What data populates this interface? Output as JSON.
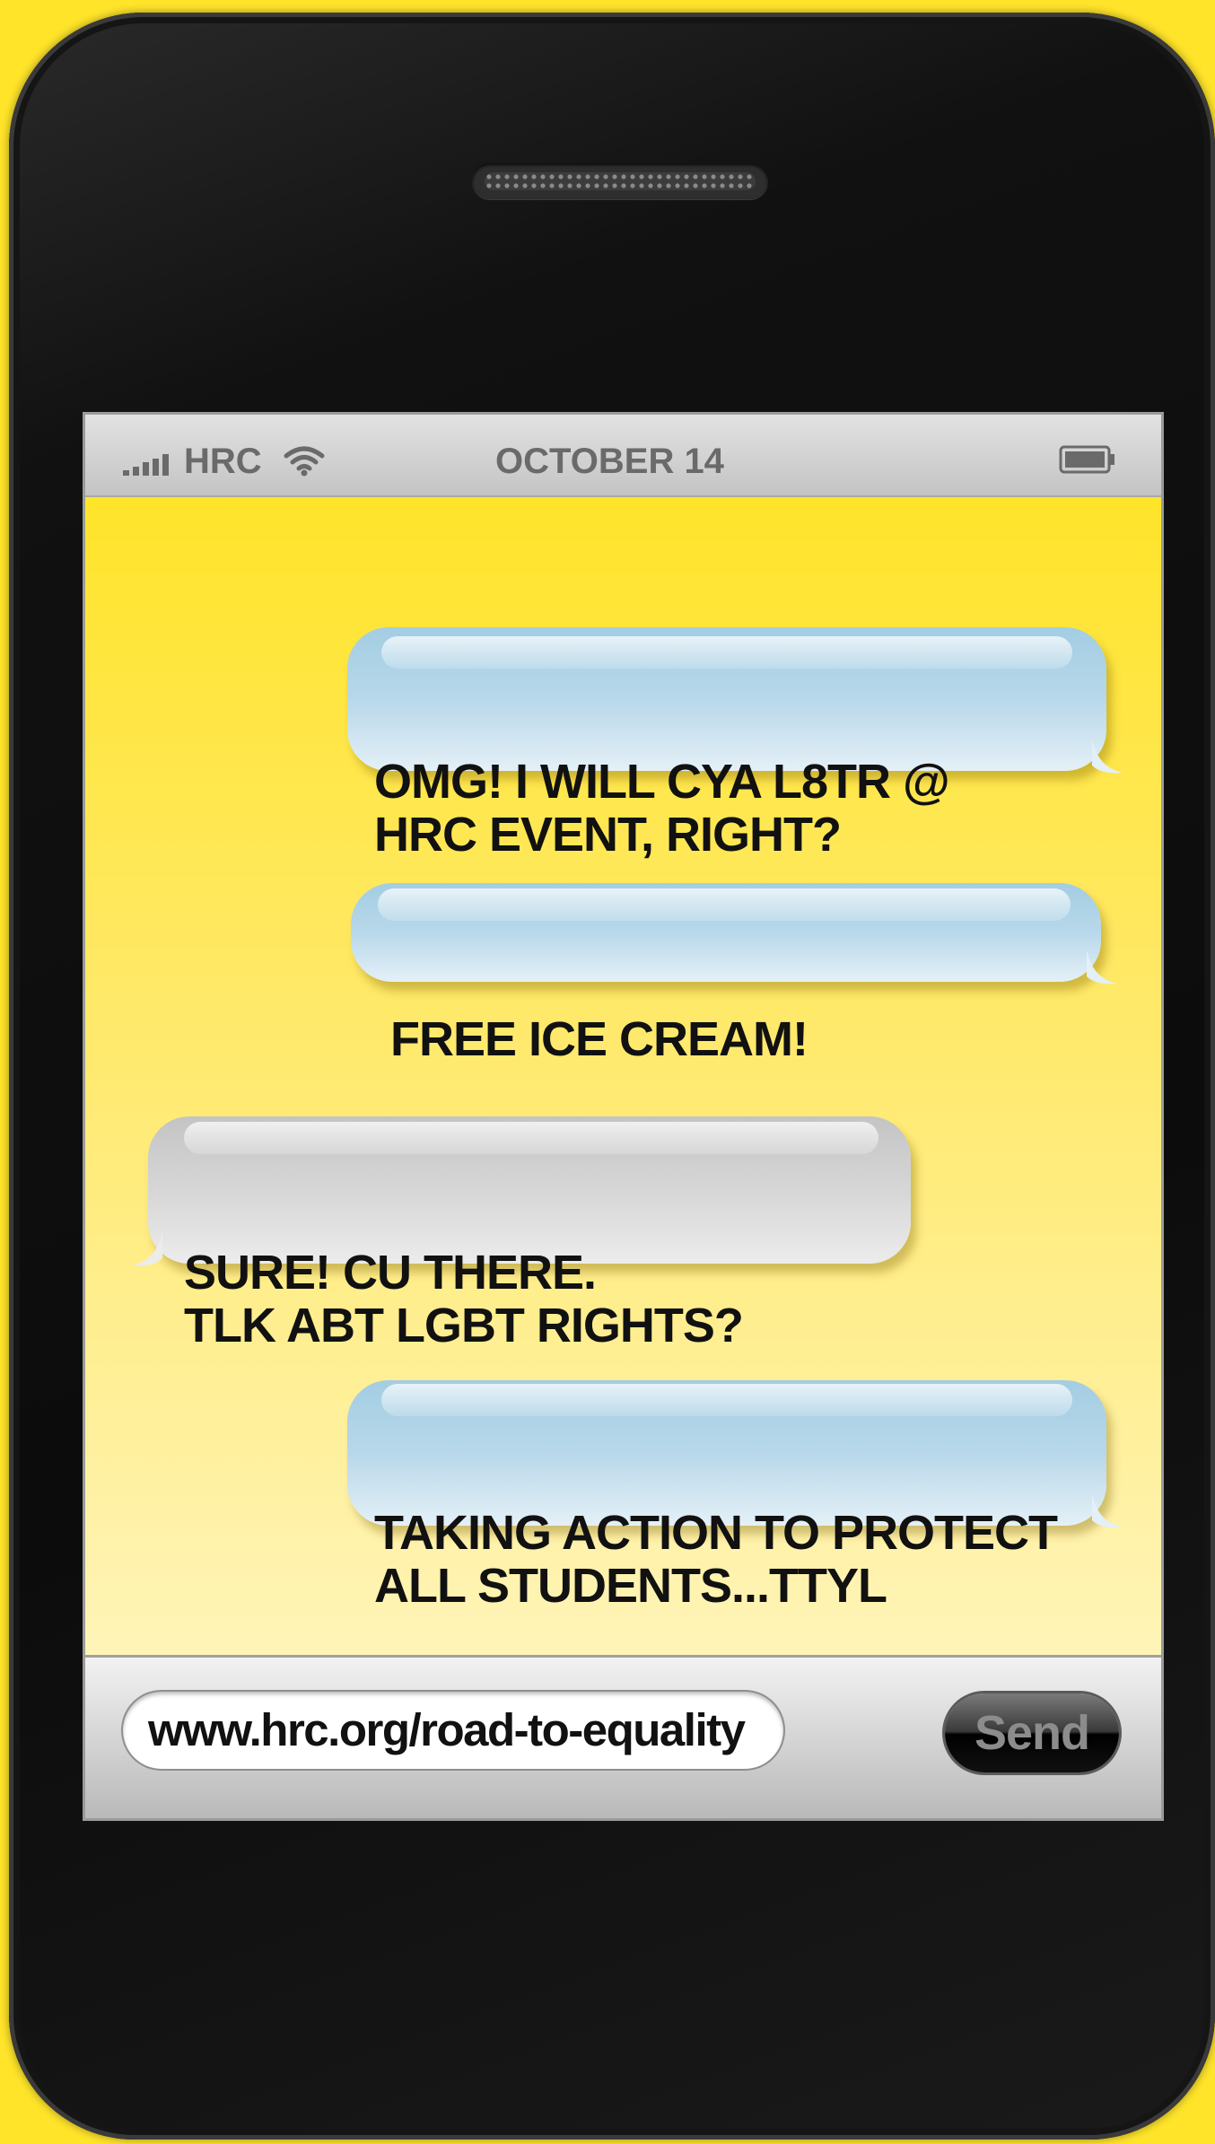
{
  "status_bar": {
    "carrier": "HRC",
    "date": "OCTOBER 14"
  },
  "messages": [
    {
      "direction": "outgoing",
      "text": "OMG! I WILL CYA L8TR @\nHRC EVENT, RIGHT?"
    },
    {
      "direction": "outgoing",
      "text": "FREE ICE CREAM!"
    },
    {
      "direction": "incoming",
      "text": "SURE! CU THERE.\nTLK ABT LGBT RIGHTS?"
    },
    {
      "direction": "outgoing",
      "text": "TAKING ACTION TO PROTECT\nALL STUDENTS...TTYL"
    }
  ],
  "input": {
    "value": "www.hrc.org/road-to-equality",
    "send_label": "Send"
  },
  "colors": {
    "background": "#ffe42a",
    "outgoing_bubble": "#a3cde3",
    "incoming_bubble": "#cfcfcf",
    "phone_body": "#111111"
  }
}
